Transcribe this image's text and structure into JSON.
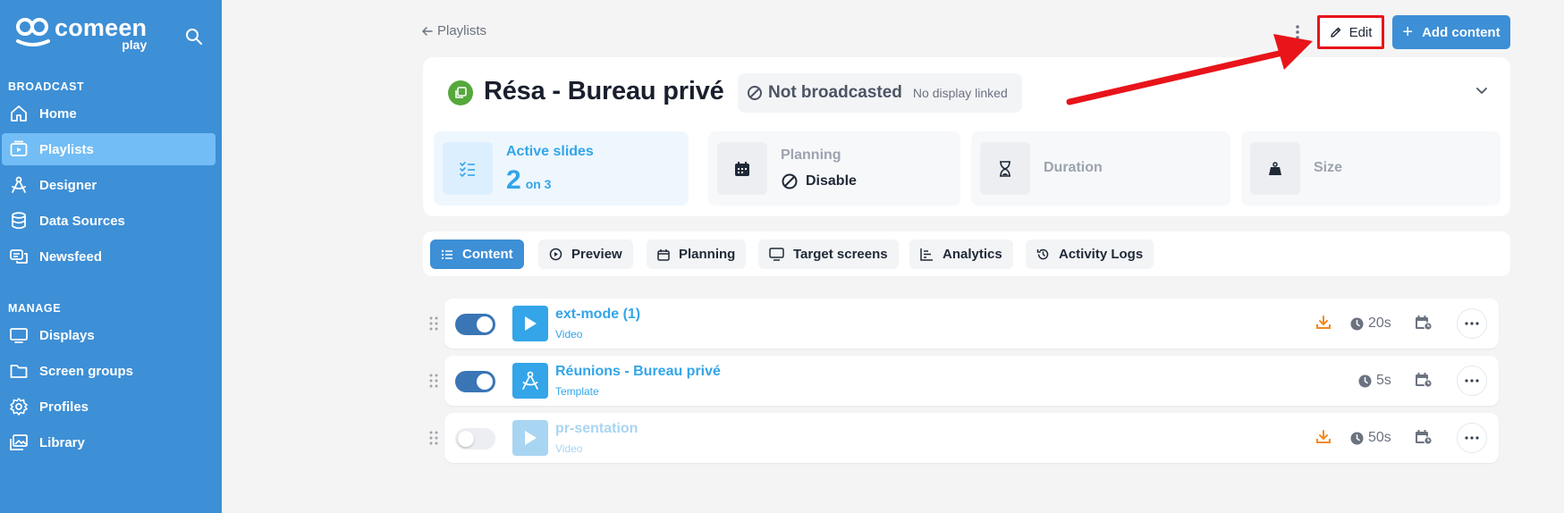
{
  "sidebar": {
    "logo": {
      "main": "comeen",
      "sub": "play"
    },
    "sections": [
      {
        "title": "BROADCAST"
      },
      {
        "title": "MANAGE"
      }
    ],
    "items": [
      {
        "label": "Home",
        "icon": "home-icon"
      },
      {
        "label": "Playlists",
        "icon": "playlist-icon",
        "active": true
      },
      {
        "label": "Designer",
        "icon": "designer-icon"
      },
      {
        "label": "Data Sources",
        "icon": "database-icon"
      },
      {
        "label": "Newsfeed",
        "icon": "newsfeed-icon"
      },
      {
        "label": "Displays",
        "icon": "monitor-icon"
      },
      {
        "label": "Screen groups",
        "icon": "folder-icon"
      },
      {
        "label": "Profiles",
        "icon": "gear-icon"
      },
      {
        "label": "Library",
        "icon": "images-icon"
      }
    ]
  },
  "topbar": {
    "back_label": "Playlists",
    "edit_label": "Edit",
    "add_label": "Add content"
  },
  "playlist": {
    "title": "Résa - Bureau privé",
    "broadcast_status": "Not broadcasted",
    "display_status": "No display linked"
  },
  "stats": {
    "active_slides": {
      "label": "Active slides",
      "count": "2",
      "suffix": "on 3"
    },
    "planning": {
      "label": "Planning",
      "value": "Disable"
    },
    "duration": {
      "label": "Duration"
    },
    "size": {
      "label": "Size"
    }
  },
  "tabs": [
    {
      "label": "Content",
      "icon": "list-icon",
      "active": true
    },
    {
      "label": "Preview",
      "icon": "play-circle-icon"
    },
    {
      "label": "Planning",
      "icon": "calendar-icon"
    },
    {
      "label": "Target screens",
      "icon": "monitor-icon"
    },
    {
      "label": "Analytics",
      "icon": "chart-icon"
    },
    {
      "label": "Activity Logs",
      "icon": "history-icon"
    }
  ],
  "rows": [
    {
      "name": "ext-mode (1)",
      "type": "Video",
      "duration": "20s",
      "enabled": true,
      "download": true
    },
    {
      "name": "Réunions - Bureau privé",
      "type": "Template",
      "duration": "5s",
      "enabled": true,
      "download": false
    },
    {
      "name": "pr-sentation",
      "type": "Video",
      "duration": "50s",
      "enabled": false,
      "download": true
    }
  ],
  "colors": {
    "sidebar": "#3d8fd6",
    "accent": "#33a5e8",
    "highlight": "#e8141a",
    "download": "#f08a24"
  }
}
